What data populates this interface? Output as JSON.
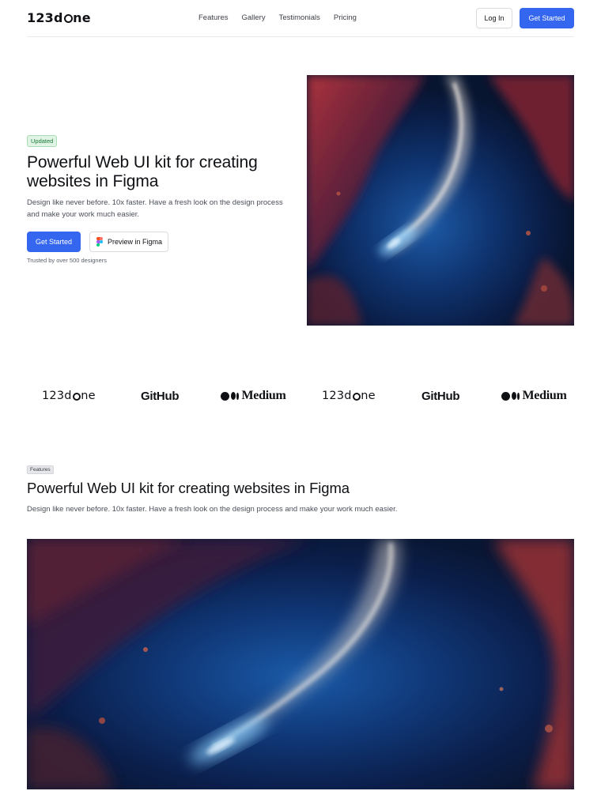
{
  "brand": {
    "logo_prefix": "123d",
    "logo_suffix": "ne"
  },
  "nav": {
    "links": [
      "Features",
      "Gallery",
      "Testimonials",
      "Pricing"
    ],
    "login_label": "Log In",
    "cta_label": "Get Started"
  },
  "hero": {
    "badge": "Updated",
    "title": "Powerful Web UI kit for creating websites in Figma",
    "subtitle": "Design like never before. 10x faster. Have a fresh look on the design process and make your work much easier.",
    "primary_cta": "Get Started",
    "secondary_cta": "Preview in Figma",
    "trusted_note": "Trusted by over 500 designers",
    "image_icon": "space-nebula-image"
  },
  "logos": {
    "items": [
      {
        "kind": "123done",
        "prefix": "123d",
        "suffix": "ne"
      },
      {
        "kind": "github",
        "text": "GitHub"
      },
      {
        "kind": "medium",
        "text": "Medium"
      },
      {
        "kind": "123done",
        "prefix": "123d",
        "suffix": "ne"
      },
      {
        "kind": "github",
        "text": "GitHub"
      },
      {
        "kind": "medium",
        "text": "Medium"
      }
    ]
  },
  "features": {
    "badge": "Features",
    "title": "Powerful Web UI kit for creating websites in Figma",
    "subtitle": "Design like never before. 10x faster. Have a fresh look on the design process and make your work much easier.",
    "image_icon": "space-nebula-image"
  },
  "colors": {
    "accent": "#3566f0",
    "text": "#0f1115",
    "muted": "#4a4f59",
    "badge_green_bg": "#dff4e4",
    "badge_green_text": "#1d7a3a",
    "figma": [
      "#f24e1e",
      "#ff7262",
      "#a259ff",
      "#1abcfe",
      "#0acf83"
    ]
  }
}
